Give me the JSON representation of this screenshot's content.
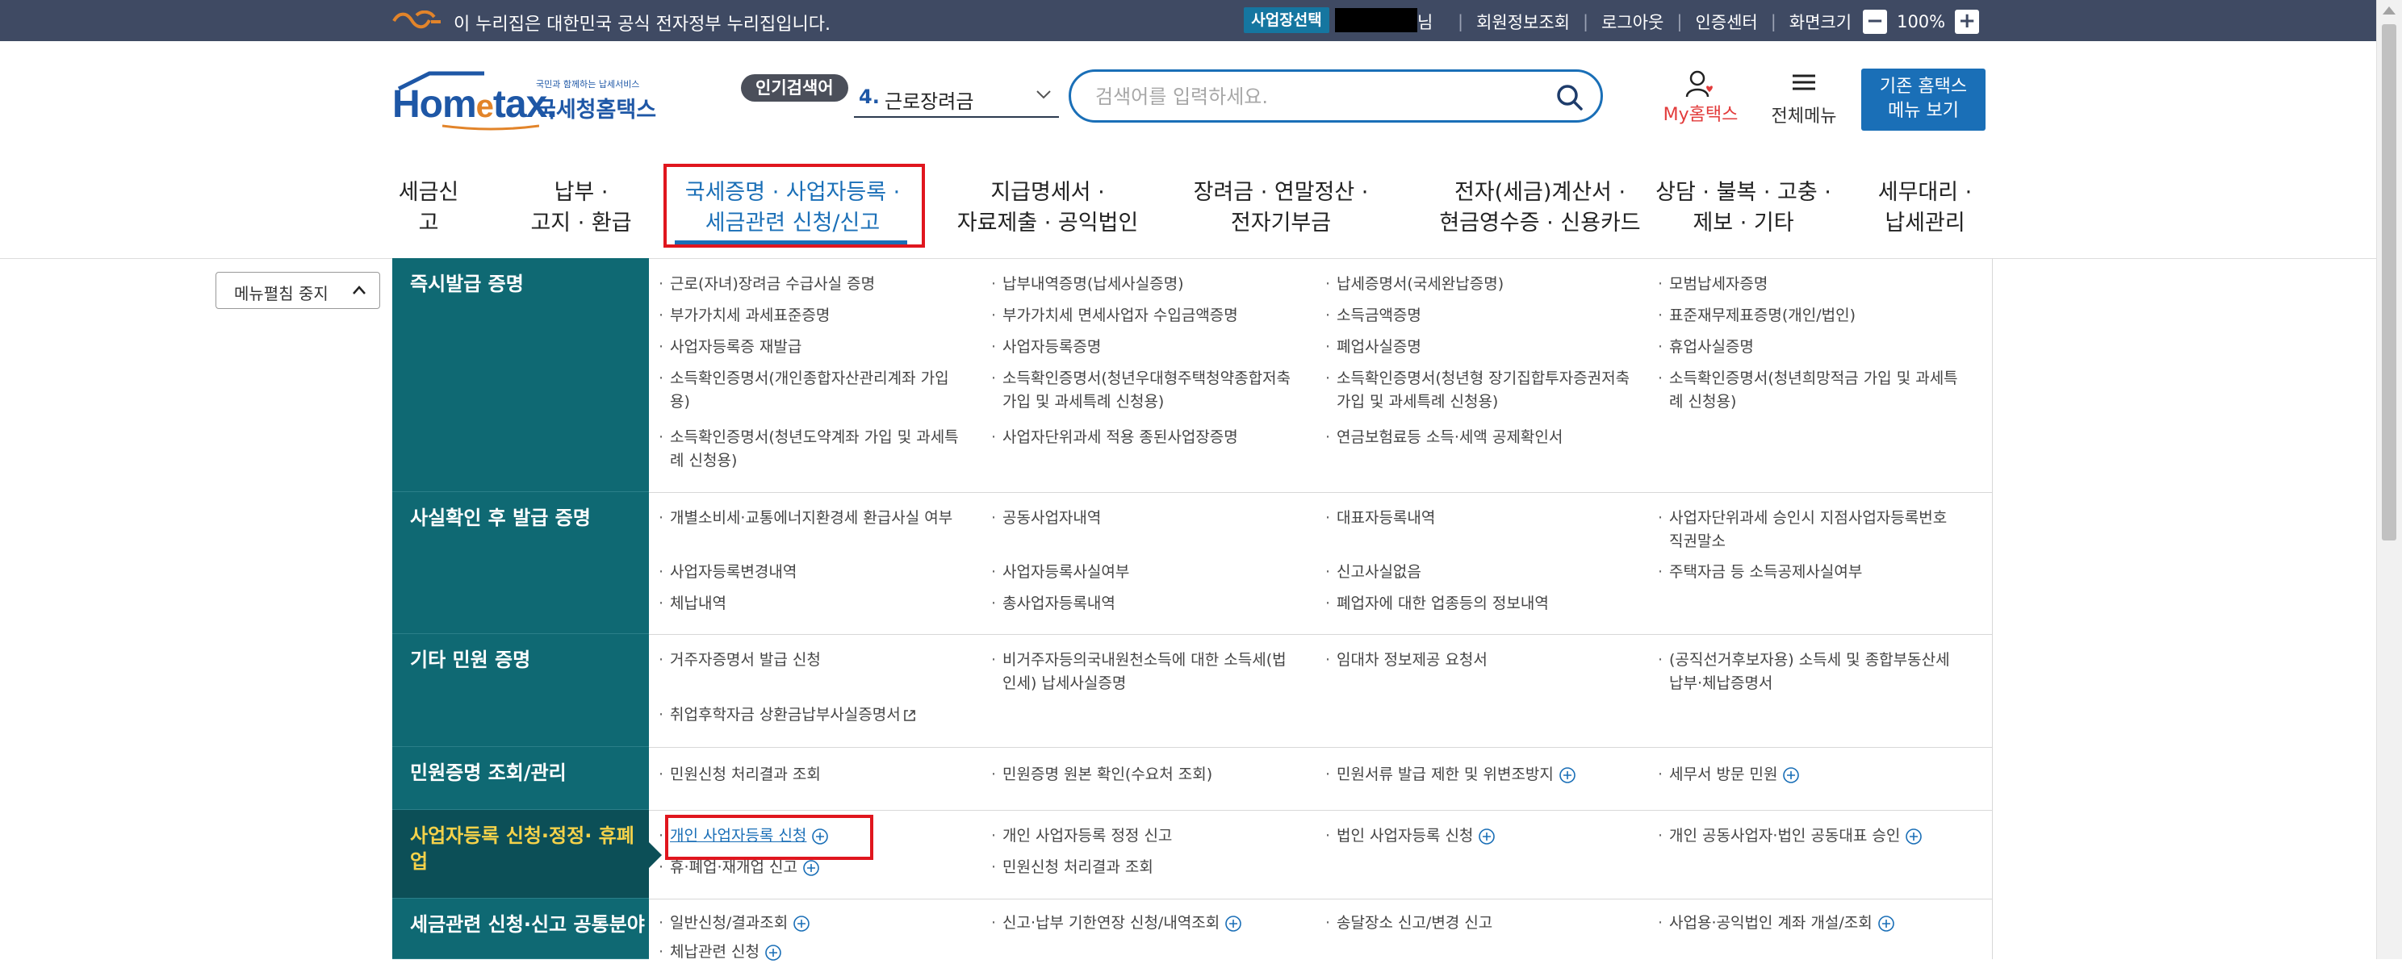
{
  "top_bar": {
    "notice": "이 누리집은 대한민국 공식 전자정부 누리집입니다.",
    "biz_select": "사업장선택",
    "user_suffix": "님",
    "links": [
      "회원정보조회",
      "로그아웃",
      "인증센터",
      "화면크기"
    ],
    "zoom_minus": "−",
    "zoom_value": "100%",
    "zoom_plus": "+"
  },
  "header": {
    "logo_tagline": "국민과 함께하는 납세서비스",
    "logo_main_left": "Hom",
    "logo_main_e": "e",
    "logo_main_right": "tax.",
    "logo_sub": "국세청홈택스",
    "popular_badge": "인기검색어",
    "popular_rank": "4.",
    "popular_keyword": "근로장려금",
    "search_placeholder": "검색어를 입력하세요.",
    "my_hometax_prefix": "My",
    "my_hometax_label": "홈택스",
    "all_menu_label": "전체메뉴",
    "old_hometax_line1": "기존 홈택스",
    "old_hometax_line2": "메뉴 보기"
  },
  "gnb": [
    {
      "label": "세금신고"
    },
    {
      "label": "납부 ·\n고지 · 환급"
    },
    {
      "label": "국세증명 · 사업자등록 ·\n세금관련 신청/신고"
    },
    {
      "label": "지급명세서 ·\n자료제출 · 공익법인"
    },
    {
      "label": "장려금 · 연말정산 ·\n전자기부금"
    },
    {
      "label": "전자(세금)계산서 ·\n현금영수증 · 신용카드"
    },
    {
      "label": "상담 · 불복 · 고충 ·\n제보 · 기타"
    },
    {
      "label": "세무대리 ·\n납세관리"
    }
  ],
  "fold_button": "메뉴펼침 중지",
  "menu": {
    "instant": {
      "title": "즉시발급 증명",
      "items": [
        "근로(자녀)장려금 수급사실 증명",
        "납부내역증명(납세사실증명)",
        "납세증명서(국세완납증명)",
        "모범납세자증명",
        "부가가치세 과세표준증명",
        "부가가치세 면세사업자 수입금액증명",
        "소득금액증명",
        "표준재무제표증명(개인/법인)",
        "사업자등록증 재발급",
        "사업자등록증명",
        "폐업사실증명",
        "휴업사실증명",
        "소득확인증명서(개인종합자산관리계좌 가입용)",
        "소득확인증명서(청년우대형주택청약종합저축 가입 및 과세특례 신청용)",
        "소득확인증명서(청년형 장기집합투자증권저축 가입 및 과세특례 신청용)",
        "소득확인증명서(청년희망적금 가입 및 과세특례 신청용)",
        "소득확인증명서(청년도약계좌 가입 및 과세특례 신청용)",
        "사업자단위과세 적용 종된사업장증명",
        "연금보험료등 소득·세액 공제확인서"
      ]
    },
    "fact": {
      "title": "사실확인 후 발급 증명",
      "items": [
        "개별소비세·교통에너지환경세 환급사실 여부",
        "공동사업자내역",
        "대표자등록내역",
        "사업자단위과세 승인시 지점사업자등록번호 직권말소",
        "사업자등록변경내역",
        "사업자등록사실여부",
        "신고사실없음",
        "주택자금 등 소득공제사실여부",
        "체납내역",
        "총사업자등록내역",
        "폐업자에 대한 업종등의 정보내역"
      ]
    },
    "other": {
      "title": "기타 민원 증명",
      "items": [
        "거주자증명서 발급 신청",
        "비거주자등의국내원천소득에 대한 소득세(법인세) 납세사실증명",
        "임대차 정보제공 요청서",
        "(공직선거후보자용) 소득세 및 종합부동산세 납부·체납증명서",
        "취업후학자금 상환금납부사실증명서"
      ]
    },
    "inquiry": {
      "title": "민원증명 조회/관리",
      "items": [
        "민원신청 처리결과 조회",
        "민원증명 원본 확인(수요처 조회)",
        "민원서류 발급 제한 및 위변조방지",
        "세무서 방문 민원"
      ]
    },
    "bizreg": {
      "title": "사업자등록 신청·정정· 휴폐업",
      "items": [
        "개인 사업자등록 신청",
        "개인 사업자등록 정정 신고",
        "법인 사업자등록 신청",
        "개인 공동사업자·법인 공동대표 승인",
        "휴·폐업·재개업 신고",
        "민원신청 처리결과 조회"
      ]
    },
    "tax": {
      "title": "세금관련 신청·신고 공통분야",
      "items": [
        "일반신청/결과조회",
        "신고·납부 기한연장 신청/내역조회",
        "송달장소 신고/변경 신고",
        "사업용·공익법인 계좌 개설/조회",
        "체납관련 신청"
      ]
    }
  },
  "colors": {
    "top_bar_bg": "#3f4a63",
    "brand_blue": "#1a6fb7",
    "menu_head_bg": "#0f6973",
    "selected_head_bg": "#0c4f57",
    "selected_head_text": "#f5d24a",
    "highlight_red": "#e0161e"
  }
}
